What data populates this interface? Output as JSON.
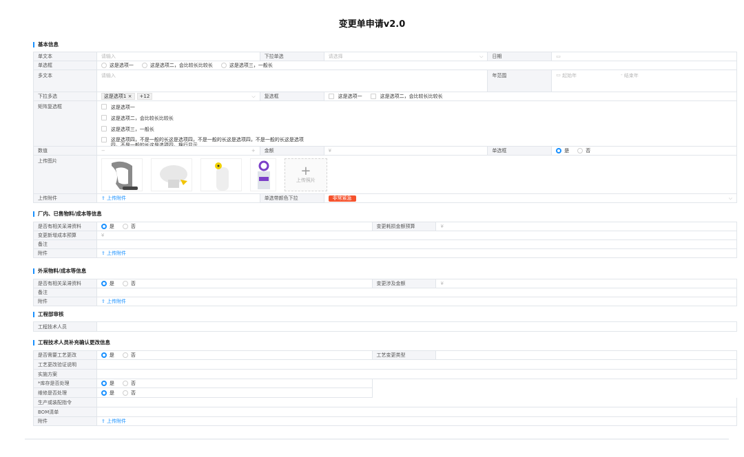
{
  "title": "变更单申请v2.0",
  "basic": {
    "header": "基本信息",
    "single_text": {
      "label": "单文本",
      "placeholder": "请输入"
    },
    "dropdown_single": {
      "label": "下拉单选",
      "placeholder": "请选择"
    },
    "date": {
      "label": "日期"
    },
    "radio": {
      "label": "单选框",
      "options": [
        "这是选项一",
        "这是选项二，会比较长比较长",
        "这是选项三，一般长"
      ]
    },
    "multi_text": {
      "label": "多文本",
      "placeholder": "请输入"
    },
    "year_range": {
      "label": "年范围",
      "start": "起始年",
      "sep": "-",
      "end": "结束年"
    },
    "dropdown_multi": {
      "label": "下拉多选",
      "tag": "这是选项1",
      "more": "+12"
    },
    "checkbox": {
      "label": "复选框",
      "options": [
        "这是选项一",
        "这是选项二，会比较长比较长"
      ]
    },
    "matrix": {
      "label": "矩阵复选框",
      "options": [
        "这是选项一",
        "这是选项二，会比较长比较长",
        "这是选项三，一般长",
        "这是选项四，不是一般的长这是选项四，不是一般的长这是选项四，不是一般的长这是选项四，不是一般的长这是选项四，换行显示"
      ]
    },
    "number": {
      "label": "数值",
      "minus": "−",
      "plus": "+"
    },
    "amount": {
      "label": "金额",
      "prefix": "¥"
    },
    "radio2": {
      "label": "单选框",
      "yes": "是",
      "no": "否"
    },
    "images": {
      "label": "上传图片",
      "add": "上传照片"
    },
    "attach": {
      "label": "上传附件",
      "link": "上传附件"
    },
    "color_dd": {
      "label": "单选带颜色下拉",
      "value": "非常紧急"
    }
  },
  "factory": {
    "header": "厂内、已售物料/成本等信息",
    "q1": {
      "label": "是否有相关呆滞资料",
      "yes": "是",
      "no": "否"
    },
    "budget": {
      "label": "变更耗损金额预算",
      "prefix": "¥"
    },
    "newcost": {
      "label": "变更新增成本预算",
      "prefix": "¥"
    },
    "remark": {
      "label": "备注"
    },
    "attach": {
      "label": "附件",
      "link": "上传附件"
    }
  },
  "external": {
    "header": "外采物料/成本等信息",
    "q1": {
      "label": "是否有相关呆滞资料",
      "yes": "是",
      "no": "否"
    },
    "amount": {
      "label": "变更涉及金额",
      "prefix": "¥"
    },
    "remark": {
      "label": "备注"
    },
    "attach": {
      "label": "附件",
      "link": "上传附件"
    }
  },
  "engdept": {
    "header": "工程部审核",
    "tech": {
      "label": "工程技术人员"
    }
  },
  "engtech": {
    "header": "工程技术人员补充确认更改信息",
    "process_change": {
      "label": "是否需要工艺更改",
      "yes": "是",
      "no": "否"
    },
    "process_type": {
      "label": "工艺变更类型"
    },
    "verify": {
      "label": "工艺更改验证说明"
    },
    "plan": {
      "label": "实施方案"
    },
    "stock": {
      "label": "*库存是否处理",
      "yes": "是",
      "no": "否"
    },
    "repair": {
      "label": "维修是否处理",
      "yes": "是",
      "no": "否"
    },
    "order": {
      "label": "生产或装配指令"
    },
    "bom": {
      "label": "BOM清单"
    },
    "attach": {
      "label": "附件",
      "link": "上传附件"
    }
  },
  "icons": {
    "upload": "upload-icon",
    "calendar": "calendar-icon",
    "chevron": "chevron-down-icon",
    "close": "close-icon"
  },
  "colors": {
    "accent": "#1890ff",
    "urgent": "#f5522d",
    "label_bg": "#f4f5f8"
  }
}
